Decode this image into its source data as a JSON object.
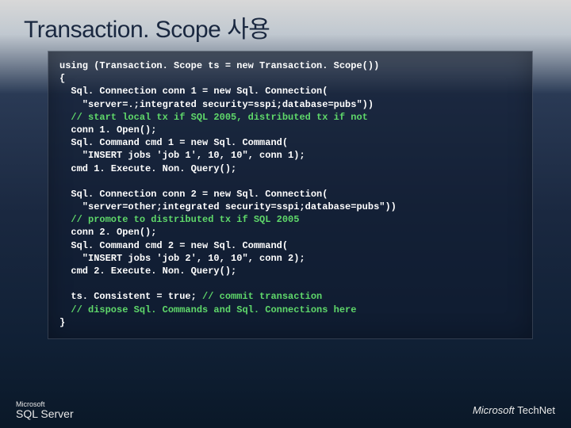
{
  "title": "Transaction. Scope 사용",
  "code": {
    "l1": "using (Transaction. Scope ts = new Transaction. Scope())",
    "l2": "{",
    "l3": "  Sql. Connection conn 1 = new Sql. Connection(",
    "l4": "    \"server=.;integrated security=sspi;database=pubs\"))",
    "l5": "  // start local tx if SQL 2005, distributed tx if not",
    "l6": "  conn 1. Open();",
    "l7": "  Sql. Command cmd 1 = new Sql. Command(",
    "l8": "    \"INSERT jobs 'job 1', 10, 10\", conn 1);",
    "l9": "  cmd 1. Execute. Non. Query();",
    "l10": "",
    "l11": "  Sql. Connection conn 2 = new Sql. Connection(",
    "l12": "    \"server=other;integrated security=sspi;database=pubs\"))",
    "l13": "  // promote to distributed tx if SQL 2005",
    "l14": "  conn 2. Open();",
    "l15": "  Sql. Command cmd 2 = new Sql. Command(",
    "l16": "    \"INSERT jobs 'job 2', 10, 10\", conn 2);",
    "l17": "  cmd 2. Execute. Non. Query();",
    "l18": "",
    "l19a": "  ts. Consistent = true; ",
    "l19b": "// commit transaction",
    "l20": "  // dispose Sql. Commands and Sql. Connections here",
    "l21": "}"
  },
  "footer": {
    "left_small": "Microsoft",
    "left_main": "SQL Server",
    "right_brand": "Microsoft",
    "right_sub": "TechNet"
  }
}
